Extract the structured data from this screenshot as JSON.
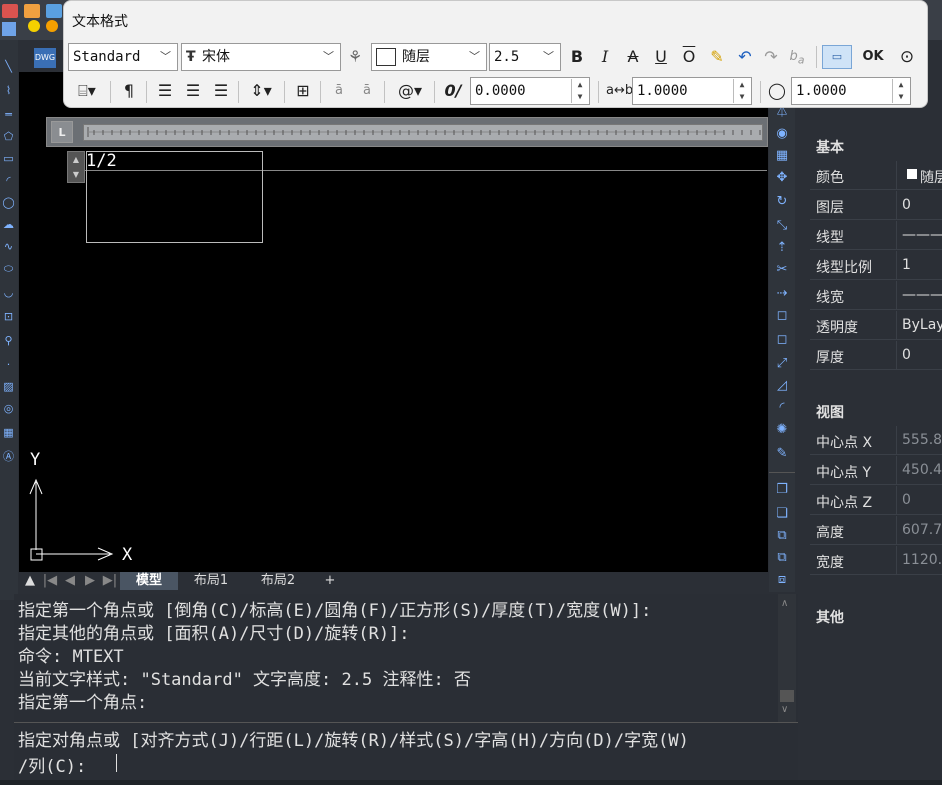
{
  "toolbar": {
    "title": "文本格式",
    "style_value": "Standard",
    "font_value": "宋体",
    "color_value": "随层",
    "height_value": "2.5",
    "bold": "B",
    "italic": "I",
    "strike": "A",
    "underline": "U",
    "overline": "O",
    "ok_label": "OK",
    "oblique_value": "0.0000",
    "tracking_value": "1.0000",
    "width_value": "1.0000",
    "symbol_label": "@"
  },
  "mtext": {
    "content": "1/2"
  },
  "ruler": {
    "label": "L"
  },
  "ucs": {
    "x_label": "X",
    "y_label": "Y"
  },
  "tabs": [
    {
      "label": "模型",
      "active": true
    },
    {
      "label": "布局1"
    },
    {
      "label": "布局2"
    },
    {
      "label": "+"
    }
  ],
  "command": {
    "history": [
      "指定第一个角点或 [倒角(C)/标高(E)/圆角(F)/正方形(S)/厚度(T)/宽度(W)]:",
      "指定其他的角点或 [面积(A)/尺寸(D)/旋转(R)]:",
      "命令: MTEXT",
      "当前文字样式: \"Standard\"  文字高度: 2.5 注释性: 否",
      "指定第一个角点:"
    ],
    "prompt_line1": "指定对角点或 [对齐方式(J)/行距(L)/旋转(R)/样式(S)/字高(H)/方向(D)/字宽(W)",
    "prompt_line2": "/列(C):"
  },
  "properties": {
    "basic_title": "基本",
    "basic": [
      {
        "key": "颜色",
        "value": "随层"
      },
      {
        "key": "图层",
        "value": "0"
      },
      {
        "key": "线型",
        "value": "———"
      },
      {
        "key": "线型比例",
        "value": "1"
      },
      {
        "key": "线宽",
        "value": "———"
      },
      {
        "key": "透明度",
        "value": "ByLay"
      },
      {
        "key": "厚度",
        "value": "0"
      }
    ],
    "view_title": "视图",
    "view": [
      {
        "key": "中心点 X",
        "value": "555.8"
      },
      {
        "key": "中心点 Y",
        "value": "450.4"
      },
      {
        "key": "中心点 Z",
        "value": "0"
      },
      {
        "key": "高度",
        "value": "607.7"
      },
      {
        "key": "宽度",
        "value": "1120."
      }
    ],
    "other_title": "其他"
  },
  "colors": {
    "canvas_bg": "#000000",
    "panel_bg": "#2b2f36",
    "toolbar_bg": "#f2f2f2",
    "accent_icon": "#7fb3ff"
  }
}
